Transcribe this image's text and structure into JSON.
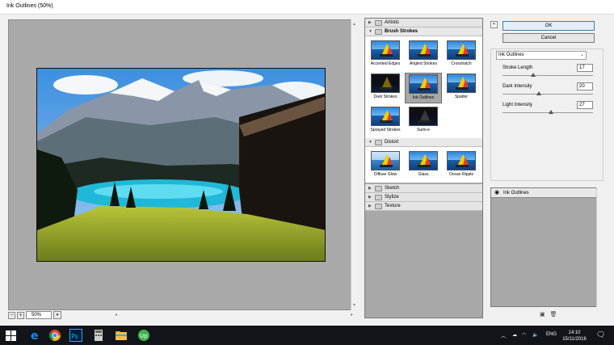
{
  "window": {
    "title": "Ink Outlines (50%)"
  },
  "preview": {
    "zoom_value": "50%",
    "zoom_out": "−",
    "zoom_in": "+",
    "dropdown": "▾"
  },
  "gallery": {
    "categories": [
      {
        "name": "Artistic",
        "expanded": false
      },
      {
        "name": "Brush Strokes",
        "expanded": true,
        "filters": [
          "Accented Edges",
          "Angled Strokes",
          "Crosshatch",
          "Dark Strokes",
          "Ink Outlines",
          "Spatter",
          "Sprayed Strokes",
          "Sumi-e"
        ]
      },
      {
        "name": "Distort",
        "expanded": true,
        "filters": [
          "Diffuse Glow",
          "Glass",
          "Ocean Ripple"
        ]
      },
      {
        "name": "Sketch",
        "expanded": false
      },
      {
        "name": "Stylize",
        "expanded": false
      },
      {
        "name": "Texture",
        "expanded": false
      }
    ],
    "selected_filter": "Ink Outlines"
  },
  "buttons": {
    "ok": "OK",
    "cancel": "Cancel",
    "collapse": "«"
  },
  "settings": {
    "filter_select": "Ink Outlines",
    "params": [
      {
        "label": "Stroke Length",
        "value": "17",
        "level": 0.34
      },
      {
        "label": "Dark Intensity",
        "value": "20",
        "level": 0.4
      },
      {
        "label": "Light Intensity",
        "value": "27",
        "level": 0.54
      }
    ]
  },
  "layers": {
    "items": [
      "Ink Outlines"
    ]
  },
  "taskbar": {
    "lang": "ENG",
    "time": "14:10",
    "date": "15/11/2016",
    "apps": [
      "start-icon",
      "edge-icon",
      "chrome-icon",
      "photoshop-icon",
      "calculator-icon",
      "file-explorer-icon",
      "upwork-icon"
    ],
    "colors": {
      "taskbar": "#111419",
      "accent": "#3c7fb1"
    }
  }
}
